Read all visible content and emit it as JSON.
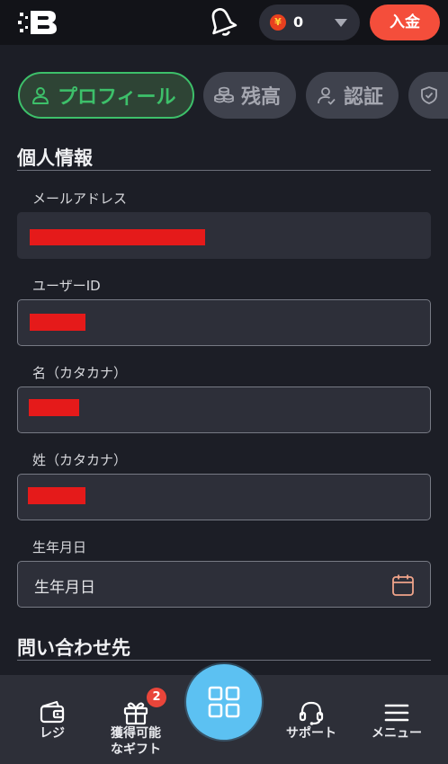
{
  "header": {
    "logo_icon": "brand-logo",
    "notifications_icon": "bell-icon",
    "balance": {
      "currency_symbol": "¥",
      "amount": "0",
      "coin_icon": "yen-coin-icon",
      "dropdown_icon": "caret-down-icon"
    },
    "deposit_label": "入金"
  },
  "tabs": [
    {
      "label": "プロフィール",
      "icon": "user-icon",
      "active": true
    },
    {
      "label": "残高",
      "icon": "coins-icon",
      "active": false
    },
    {
      "label": "認証",
      "icon": "id-check-icon",
      "active": false
    },
    {
      "label": "",
      "icon": "shield-icon",
      "active": false
    }
  ],
  "personal_info": {
    "title": "個人情報",
    "email": {
      "label": "メールアドレス"
    },
    "user_id": {
      "label": "ユーザーID"
    },
    "first_name": {
      "label": "名（カタカナ）"
    },
    "last_name": {
      "label": "姓（カタカナ）"
    },
    "birthdate": {
      "label": "生年月日",
      "placeholder": "生年月日",
      "icon": "calendar-icon"
    }
  },
  "contact": {
    "title": "問い合わせ先"
  },
  "bottom_nav": {
    "items": [
      {
        "label": "レジ",
        "icon": "wallet-icon"
      },
      {
        "label": "獲得可能\nなギフト",
        "label_line1": "獲得可能",
        "label_line2": "なギフト",
        "icon": "gift-icon",
        "badge": "2"
      },
      {
        "label": "",
        "icon": "grid-icon"
      },
      {
        "label": "サポート",
        "icon": "headset-icon"
      },
      {
        "label": "メニュー",
        "icon": "menu-icon"
      }
    ]
  },
  "colors": {
    "background": "#1c1e26",
    "header": "#121318",
    "accent_green": "#3dc06a",
    "deposit_red": "#f44e3b",
    "fab_blue": "#5cc1f2",
    "redaction_red": "#e51a1a"
  }
}
